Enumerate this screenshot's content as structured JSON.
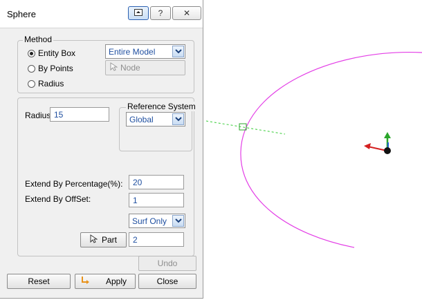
{
  "window": {
    "title": "Sphere"
  },
  "title_buttons": [
    {
      "name": "pin-icon"
    },
    {
      "name": "help-icon",
      "glyph": "?"
    },
    {
      "name": "close-icon",
      "glyph": "✕"
    }
  ],
  "method": {
    "legend": "Method",
    "options": [
      {
        "label": "Entity Box",
        "checked": true
      },
      {
        "label": "By Points",
        "checked": false
      },
      {
        "label": "Radius",
        "checked": false
      }
    ],
    "scope_select": "Entire Model",
    "node_button": "Node"
  },
  "radius": {
    "label": "Radius",
    "value": "15"
  },
  "reference_system": {
    "legend": "Reference System",
    "select": "Global"
  },
  "extend": {
    "percentage_label": "Extend By Percentage(%):",
    "percentage_value": "20",
    "offset_label": "Extend By OffSet:",
    "offset_value": "1",
    "surf_select": "Surf Only",
    "part_button": "Part",
    "part_value": "2"
  },
  "buttons": {
    "undo": "Undo",
    "reset": "Reset",
    "apply": "Apply",
    "close": "Close"
  },
  "colors": {
    "accent_text": "#1f4fa0",
    "arc": "#e33de6",
    "guide_line": "#33cc33",
    "axis_red": "#d42020",
    "axis_green": "#2aa62a",
    "axis_blue": "#2060d0"
  }
}
